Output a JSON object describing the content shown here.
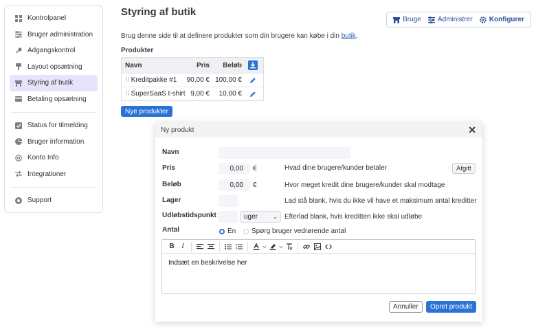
{
  "sidebar": {
    "items": [
      {
        "label": "Kontrolpanel",
        "icon": "dashboard-icon"
      },
      {
        "label": "Bruger administration",
        "icon": "sliders-icon"
      },
      {
        "label": "Adgangskontrol",
        "icon": "key-icon"
      },
      {
        "label": "Layout opsætning",
        "icon": "brush-icon"
      },
      {
        "label": "Styring af butik",
        "icon": "store-icon",
        "active": true
      },
      {
        "label": "Betaling opsætning",
        "icon": "credit-card-icon"
      },
      {
        "label": "Status for tilmelding",
        "icon": "checkbox-icon"
      },
      {
        "label": "Bruger information",
        "icon": "pie-chart-icon"
      },
      {
        "label": "Konto Info",
        "icon": "at-icon"
      },
      {
        "label": "Integrationer",
        "icon": "arrows-icon"
      },
      {
        "label": "Support",
        "icon": "help-icon"
      }
    ]
  },
  "header": {
    "title": "Styring af butik",
    "buttons": {
      "use": "Bruge",
      "manage": "Administrer",
      "configure": "Konfigurer"
    }
  },
  "intro": {
    "text": "Brug denne side til at definere produkter som din brugere kan købe i din ",
    "link": "butik",
    "tail": "."
  },
  "products": {
    "label": "Produkter",
    "columns": {
      "name": "Navn",
      "price": "Pris",
      "amount": "Beløb"
    },
    "rows": [
      {
        "name": "Kreditpakke #1",
        "price": "90,00 €",
        "amount": "100,00 €"
      },
      {
        "name": "SuperSaaS t-shirt",
        "price": "9,00 €",
        "amount": "10,00 €"
      }
    ],
    "new_button": "Nye produkter"
  },
  "modal": {
    "title": "Ny produkt",
    "close": "✕",
    "fields": {
      "name": {
        "label": "Navn",
        "value": ""
      },
      "price": {
        "label": "Pris",
        "value": "0,00",
        "unit": "€",
        "help": "Hvad dine brugere/kunder betaler",
        "extra_button": "Afgift"
      },
      "amount": {
        "label": "Beløb",
        "value": "0,00",
        "unit": "€",
        "help": "Hvor meget kredit dine brugere/kunder skal modtage"
      },
      "stock": {
        "label": "Lager",
        "value": "",
        "help": "Lad stå blank, hvis du ikke vil have et maksimum antal kreditter"
      },
      "expiry": {
        "label": "Udløbstidspunkt",
        "value": "",
        "unit_select": "uger",
        "help": "Efterlad blank, hvis kreditten ikke skal udløbe"
      },
      "quantity": {
        "label": "Antal",
        "option_one": "En",
        "option_ask": "Spørg bruger vedrørende antal"
      }
    },
    "editor": {
      "text": "Indsæt en beskrivelse her"
    },
    "cancel": "Annuller",
    "create": "Opret produkt"
  },
  "colors": {
    "accent": "#2a72d6",
    "active_nav": "#e6e3fb",
    "link": "#2a5db0"
  }
}
